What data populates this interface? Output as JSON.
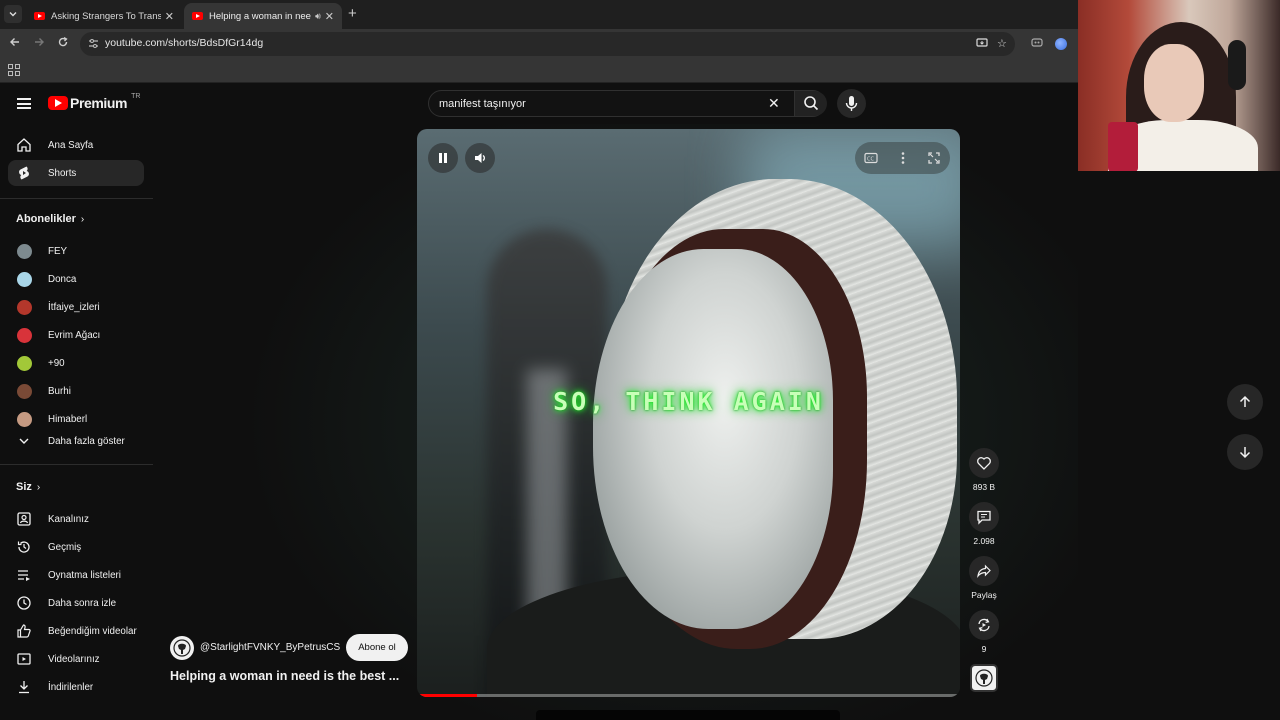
{
  "browser": {
    "tabs": [
      {
        "title": "Asking Strangers To Transform",
        "active": false
      },
      {
        "title": "Helping a woman in need i",
        "active": true
      }
    ],
    "url": "youtube.com/shorts/BdsDfGr14dg"
  },
  "masthead": {
    "logo_text": "Premium",
    "logo_badge": "TR",
    "search_value": "manifest taşınıyor"
  },
  "sidebar": {
    "main": [
      {
        "label": "Ana Sayfa",
        "icon": "home-icon"
      },
      {
        "label": "Shorts",
        "icon": "shorts-icon",
        "active": true
      }
    ],
    "subscriptions_title": "Abonelikler",
    "subscriptions": [
      {
        "label": "FEY",
        "color": "#7d8a8f"
      },
      {
        "label": "Donca",
        "color": "#a9d6e8"
      },
      {
        "label": "İtfaiye_izleri",
        "color": "#b3372b"
      },
      {
        "label": "Evrim Ağacı",
        "color": "#d8333a"
      },
      {
        "label": "+90",
        "color": "#a2c838"
      },
      {
        "label": "Burhi",
        "color": "#7a4a36"
      },
      {
        "label": "Himaberl",
        "color": "#c59a82"
      }
    ],
    "show_more": "Daha fazla göster",
    "you_title": "Siz",
    "you": [
      {
        "label": "Kanalınız",
        "icon": "channel-icon"
      },
      {
        "label": "Geçmiş",
        "icon": "history-icon"
      },
      {
        "label": "Oynatma listeleri",
        "icon": "playlist-icon"
      },
      {
        "label": "Daha sonra izle",
        "icon": "clock-icon"
      },
      {
        "label": "Beğendiğim videolar",
        "icon": "thumbs-up-icon"
      },
      {
        "label": "Videolarınız",
        "icon": "video-icon"
      },
      {
        "label": "İndirilenler",
        "icon": "download-icon"
      }
    ]
  },
  "short": {
    "caption": "SO, THINK AGAIN",
    "channel": "@StarlightFVNKY_ByPetrusCS",
    "subscribe_label": "Abone ol",
    "title": "Helping a woman in need is the best ...",
    "progress": 0.11,
    "actions": {
      "likes": "893 B",
      "comments": "2.098",
      "share": "Paylaş",
      "remix": "9"
    }
  },
  "colors": {
    "accent": "#ff0000",
    "caption_glow": "#29ff33",
    "surface": "#272727"
  }
}
